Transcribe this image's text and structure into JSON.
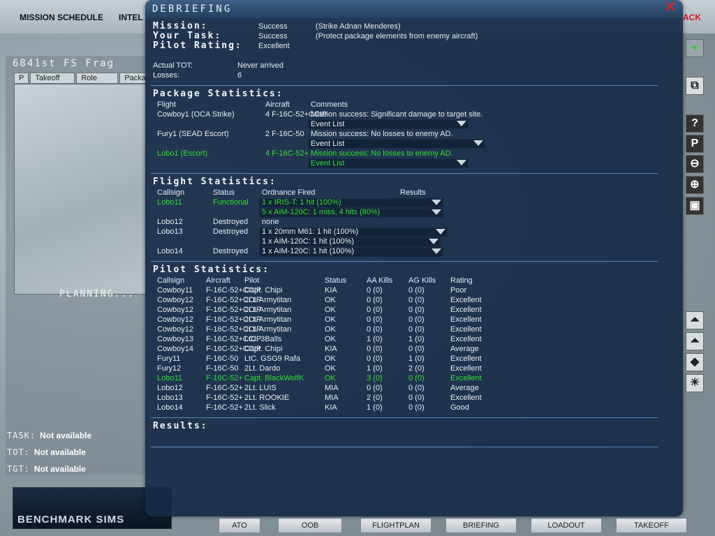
{
  "topmenu": {
    "mission_schedule": "MISSION SCHEDULE",
    "intel": "INTEL",
    "back": "ACK"
  },
  "frag": {
    "title": "6841st FS Frag",
    "tabs": [
      "P",
      "Takeoff",
      "Role",
      "Package"
    ],
    "planning": "PLANNING...",
    "task_label": "TASK:",
    "task_value": "Not available",
    "tot_label": "TOT:",
    "tot_value": "Not available",
    "tgt_label": "TGT:",
    "tgt_value": "Not available"
  },
  "logo": {
    "text": "BENCHMARK SIMS"
  },
  "bottom_buttons": [
    "ATO",
    "OOB",
    "FLIGHTPLAN",
    "BRIEFING",
    "LOADOUT",
    "TAKEOFF"
  ],
  "window": {
    "title": "DEBRIEFING",
    "mission_label": "Mission:",
    "mission_status": "Success",
    "mission_detail": "(Strike Adnan Menderes)",
    "task_label": "Your Task:",
    "task_status": "Success",
    "task_detail": "(Protect package elements from enemy aircraft)",
    "rating_label": "Pilot Rating:",
    "rating_value": "Excellent",
    "actual_tot_label": "Actual TOT:",
    "actual_tot_value": "Never arrived",
    "losses_label": "Losses:",
    "losses_value": "6",
    "package_header": "Package Statistics:",
    "package_cols": {
      "flight": "Flight",
      "aircraft": "Aircraft",
      "comments": "Comments"
    },
    "package_rows": [
      {
        "flight": "Cowboy1 (OCA Strike)",
        "aircraft": "4 F-16C-52+CCIP",
        "comment": "Mission success: Significant damage to target site.",
        "event": "Event List",
        "highlight": false
      },
      {
        "flight": "Fury1 (SEAD Escort)",
        "aircraft": "2 F-16C-50",
        "comment": "Mission success: No losses to enemy AD.",
        "event": "Event List",
        "highlight": false
      },
      {
        "flight": "Lobo1 (Escort)",
        "aircraft": "4 F-16C-52+",
        "comment": "Mission success: No losses to enemy AD.",
        "event": "Event List",
        "highlight": true
      }
    ],
    "flight_header": "Flight Statistics:",
    "flight_cols": {
      "callsign": "Callsign",
      "status": "Status",
      "ordnance": "Ordnance Fired",
      "results": "Results"
    },
    "flight_rows": [
      {
        "callsign": "Lobo11",
        "status": "Functional",
        "ordnance": "1 x IRIS-T: 1 hit (100%)",
        "highlight": true
      },
      {
        "callsign": "",
        "status": "",
        "ordnance": "5 x AIM-120C: 1 miss, 4 hits (80%)",
        "highlight": true
      },
      {
        "callsign": "Lobo12",
        "status": "Destroyed",
        "ordnance": "none",
        "highlight": false
      },
      {
        "callsign": "Lobo13",
        "status": "Destroyed",
        "ordnance": "1 x 20mm M61: 1 hit (100%)",
        "highlight": false
      },
      {
        "callsign": "",
        "status": "",
        "ordnance": "1 x AIM-120C: 1 hit (100%)",
        "highlight": false
      },
      {
        "callsign": "Lobo14",
        "status": "Destroyed",
        "ordnance": "1 x AIM-120C: 1 hit (100%)",
        "highlight": false
      }
    ],
    "pilot_header": "Pilot Statistics:",
    "pilot_cols": {
      "callsign": "Callsign",
      "aircraft": "Aircraft",
      "pilot": "Pilot",
      "status": "Status",
      "aa": "AA Kills",
      "ag": "AG Kills",
      "rating": "Rating"
    },
    "pilot_rows": [
      {
        "callsign": "Cowboy11",
        "aircraft": "F-16C-52+CCIP",
        "pilot": "Capt. Chipi",
        "status": "KIA",
        "aa": "0 (0)",
        "ag": "0 (0)",
        "rating": "Poor",
        "highlight": false
      },
      {
        "callsign": "Cowboy12",
        "aircraft": "F-16C-52+CCIP",
        "pilot": "2Lt. Armytitan",
        "status": "OK",
        "aa": "0 (0)",
        "ag": "0 (0)",
        "rating": "Excellent",
        "highlight": false
      },
      {
        "callsign": "Cowboy12",
        "aircraft": "F-16C-52+CCIP",
        "pilot": "2Lt. Armytitan",
        "status": "OK",
        "aa": "0 (0)",
        "ag": "0 (0)",
        "rating": "Excellent",
        "highlight": false
      },
      {
        "callsign": "Cowboy12",
        "aircraft": "F-16C-52+CCIP",
        "pilot": "2Lt. Armytitan",
        "status": "OK",
        "aa": "0 (0)",
        "ag": "0 (0)",
        "rating": "Excellent",
        "highlight": false
      },
      {
        "callsign": "Cowboy12",
        "aircraft": "F-16C-52+CCIP",
        "pilot": "2Lt. Armytitan",
        "status": "OK",
        "aa": "0 (0)",
        "ag": "0 (0)",
        "rating": "Excellent",
        "highlight": false
      },
      {
        "callsign": "Cowboy13",
        "aircraft": "F-16C-52+CCIP",
        "pilot": "LtC. 3Balls",
        "status": "OK",
        "aa": "1 (0)",
        "ag": "1 (0)",
        "rating": "Excellent",
        "highlight": false
      },
      {
        "callsign": "Cowboy14",
        "aircraft": "F-16C-52+CCIP",
        "pilot": "Capt. Chipi",
        "status": "KIA",
        "aa": "0 (0)",
        "ag": "0 (0)",
        "rating": "Average",
        "highlight": false
      },
      {
        "callsign": "Fury11",
        "aircraft": "F-16C-50",
        "pilot": "LtC. GSG9 Rafa",
        "status": "OK",
        "aa": "0 (0)",
        "ag": "1 (0)",
        "rating": "Excellent",
        "highlight": false
      },
      {
        "callsign": "Fury12",
        "aircraft": "F-16C-50",
        "pilot": "2Lt. Dardo",
        "status": "OK",
        "aa": "1 (0)",
        "ag": "2 (0)",
        "rating": "Excellent",
        "highlight": false
      },
      {
        "callsign": "Lobo11",
        "aircraft": "F-16C-52+",
        "pilot": "Capt. BlackWolfK",
        "status": "OK",
        "aa": "3 (0)",
        "ag": "0 (0)",
        "rating": "Excellent",
        "highlight": true
      },
      {
        "callsign": "Lobo12",
        "aircraft": "F-16C-52+",
        "pilot": "2Lt. LUIS",
        "status": "MIA",
        "aa": "0 (0)",
        "ag": "0 (0)",
        "rating": "Average",
        "highlight": false
      },
      {
        "callsign": "Lobo13",
        "aircraft": "F-16C-52+",
        "pilot": "2Lt. ROOKIE",
        "status": "MIA",
        "aa": "2 (0)",
        "ag": "0 (0)",
        "rating": "Excellent",
        "highlight": false
      },
      {
        "callsign": "Lobo14",
        "aircraft": "F-16C-52+",
        "pilot": "2Lt. Slick",
        "status": "KIA",
        "aa": "1 (0)",
        "ag": "0 (0)",
        "rating": "Good",
        "highlight": false
      }
    ],
    "results_header": "Results:"
  },
  "tools": [
    "?",
    "P"
  ],
  "colors": {
    "highlight": "#33dd33",
    "window_bg": "#162a48",
    "close": "#e02020"
  }
}
